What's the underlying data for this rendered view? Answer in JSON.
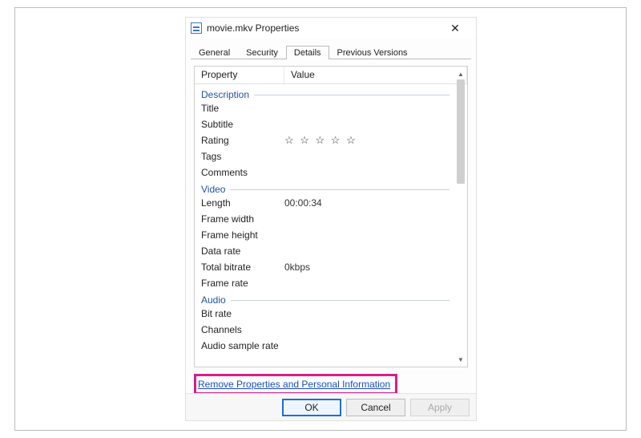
{
  "titlebar": {
    "title": "movie.mkv Properties",
    "close_glyph": "✕"
  },
  "tabs": [
    {
      "label": "General"
    },
    {
      "label": "Security"
    },
    {
      "label": "Details"
    },
    {
      "label": "Previous Versions"
    }
  ],
  "selected_tab_index": 2,
  "list": {
    "col_property": "Property",
    "col_value": "Value",
    "groups": [
      {
        "name": "Description",
        "rows": [
          {
            "name": "Title",
            "value": ""
          },
          {
            "name": "Subtitle",
            "value": ""
          },
          {
            "name": "Rating",
            "value": "",
            "stars": true
          },
          {
            "name": "Tags",
            "value": ""
          },
          {
            "name": "Comments",
            "value": ""
          }
        ]
      },
      {
        "name": "Video",
        "rows": [
          {
            "name": "Length",
            "value": "00:00:34"
          },
          {
            "name": "Frame width",
            "value": ""
          },
          {
            "name": "Frame height",
            "value": ""
          },
          {
            "name": "Data rate",
            "value": ""
          },
          {
            "name": "Total bitrate",
            "value": "0kbps"
          },
          {
            "name": "Frame rate",
            "value": ""
          }
        ]
      },
      {
        "name": "Audio",
        "rows": [
          {
            "name": "Bit rate",
            "value": ""
          },
          {
            "name": "Channels",
            "value": ""
          },
          {
            "name": "Audio sample rate",
            "value": ""
          }
        ]
      }
    ]
  },
  "stars_glyph": "☆ ☆ ☆ ☆ ☆",
  "scroll_up_glyph": "▲",
  "scroll_down_glyph": "▼",
  "remove_link_label": "Remove Properties and Personal Information",
  "buttons": {
    "ok": "OK",
    "cancel": "Cancel",
    "apply": "Apply"
  },
  "highlight_color": "#d81e8c"
}
